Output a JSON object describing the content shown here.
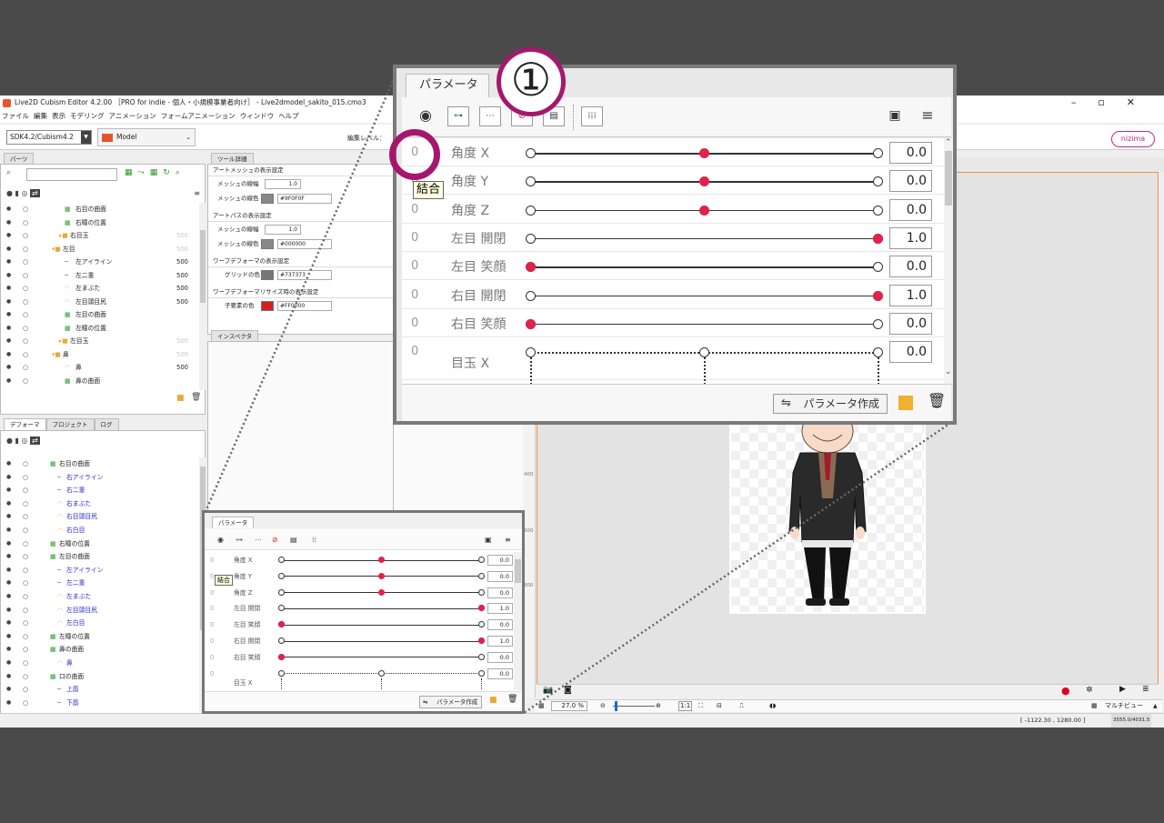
{
  "app": {
    "title": "Live2D Cubism Editor 4.2.00 ［PRO for indie - 個人・小規模事業者向け］ - Live2dmodel_sakito_015.cmo3",
    "menu": [
      "ファイル",
      "編集",
      "表示",
      "モデリング",
      "アニメーション",
      "フォームアニメーション",
      "ウィンドウ",
      "ヘルプ"
    ],
    "sdk_select": "SDK4.2/Cubism4.2",
    "model_label": "Model",
    "edit_level_label": "編集レベル：",
    "nizima": "nizima",
    "window_controls": [
      "–",
      "▫",
      "✕"
    ]
  },
  "parts_panel": {
    "tab": "パーツ",
    "items": [
      {
        "label": "右目の曲面",
        "num": "",
        "indent": 70,
        "color": "",
        "icon": "deformer"
      },
      {
        "label": "右瞳の位置",
        "num": "",
        "indent": 70,
        "color": "",
        "icon": "deformer"
      },
      {
        "label": "右目玉",
        "num": "500",
        "indent": 64,
        "color": "",
        "icon": "folder",
        "dim_num": true
      },
      {
        "label": "左目",
        "num": "500",
        "indent": 56,
        "color": "",
        "icon": "folder-open",
        "dim_num": true
      },
      {
        "label": "左アイライン",
        "num": "500",
        "indent": 70,
        "color": "",
        "icon": "line"
      },
      {
        "label": "左二重",
        "num": "500",
        "indent": 70,
        "color": "",
        "icon": "line"
      },
      {
        "label": "左まぶた",
        "num": "500",
        "indent": 70,
        "color": "",
        "icon": "mesh"
      },
      {
        "label": "左目頭目尻",
        "num": "500",
        "indent": 70,
        "color": "",
        "icon": "mesh"
      },
      {
        "label": "左目の曲面",
        "num": "",
        "indent": 70,
        "color": "",
        "icon": "deformer"
      },
      {
        "label": "左瞳の位置",
        "num": "",
        "indent": 70,
        "color": "",
        "icon": "deformer"
      },
      {
        "label": "左目玉",
        "num": "500",
        "indent": 64,
        "color": "",
        "icon": "folder",
        "dim_num": true
      },
      {
        "label": "鼻",
        "num": "500",
        "indent": 56,
        "color": "",
        "icon": "folder-open",
        "dim_num": true
      },
      {
        "label": "鼻",
        "num": "500",
        "indent": 70,
        "color": "",
        "icon": "mesh"
      },
      {
        "label": "鼻の曲面",
        "num": "",
        "indent": 70,
        "color": "",
        "icon": "deformer"
      }
    ]
  },
  "tool_detail": {
    "tab": "ツール詳細",
    "sections": [
      {
        "title": "アートメッシュの表示設定",
        "rows": [
          {
            "label": "メッシュの線幅",
            "value": "1.0"
          },
          {
            "label": "メッシュの線色",
            "hex": "#9F0F0F",
            "swatch": "#888888"
          }
        ]
      },
      {
        "title": "アートパスの表示設定",
        "rows": [
          {
            "label": "メッシュの線幅",
            "value": "1.0"
          },
          {
            "label": "メッシュの線色",
            "hex": "#000000",
            "swatch": "#888888"
          }
        ]
      },
      {
        "title": "ワープデフォーマの表示設定",
        "rows": [
          {
            "label": "グリッドの色",
            "hex": "#737373",
            "swatch": "#777777"
          }
        ]
      },
      {
        "title": "ワープデフォーマリサイズ時の表示設定",
        "rows": [
          {
            "label": "子要素の色",
            "hex": "#FF0000",
            "swatch": "#d42020"
          }
        ]
      }
    ],
    "inspector_tab": "インスペクタ"
  },
  "deformer_panel": {
    "tabs": [
      "デフォーマ",
      "プロジェクト",
      "ログ"
    ],
    "items": [
      {
        "label": "右目の曲面",
        "indent": 54,
        "color": "",
        "icon": "deformer"
      },
      {
        "label": "右アイライン",
        "indent": 62,
        "color": "blue",
        "icon": "line"
      },
      {
        "label": "右二重",
        "indent": 62,
        "color": "blue",
        "icon": "line"
      },
      {
        "label": "右まぶた",
        "indent": 62,
        "color": "blue",
        "icon": "mesh"
      },
      {
        "label": "右目頭目尻",
        "indent": 62,
        "color": "blue",
        "icon": "mesh"
      },
      {
        "label": "右白目",
        "indent": 62,
        "color": "blue",
        "icon": "mesh"
      },
      {
        "label": "右瞳の位置",
        "indent": 54,
        "color": "",
        "icon": "deformer"
      },
      {
        "label": "左目の曲面",
        "indent": 54,
        "color": "",
        "icon": "deformer"
      },
      {
        "label": "左アイライン",
        "indent": 62,
        "color": "blue",
        "icon": "line"
      },
      {
        "label": "左二重",
        "indent": 62,
        "color": "blue",
        "icon": "line"
      },
      {
        "label": "左まぶた",
        "indent": 62,
        "color": "blue",
        "icon": "mesh"
      },
      {
        "label": "左目頭目尻",
        "indent": 62,
        "color": "blue",
        "icon": "mesh"
      },
      {
        "label": "左白目",
        "indent": 62,
        "color": "blue",
        "icon": "mesh"
      },
      {
        "label": "左瞳の位置",
        "indent": 54,
        "color": "",
        "icon": "deformer"
      },
      {
        "label": "鼻の曲面",
        "indent": 54,
        "color": "",
        "icon": "deformer"
      },
      {
        "label": "鼻",
        "indent": 62,
        "color": "blue",
        "icon": "mesh"
      },
      {
        "label": "口の曲面",
        "indent": 54,
        "color": "",
        "icon": "deformer"
      },
      {
        "label": "上唇",
        "indent": 62,
        "color": "blue",
        "icon": "line"
      },
      {
        "label": "下唇",
        "indent": 62,
        "color": "blue",
        "icon": "line"
      }
    ]
  },
  "parameters": {
    "tab": "パラメータ",
    "tooltip": "結合",
    "create_button": "パラメータ作成",
    "items": [
      {
        "name": "角度 X",
        "value": "0.0",
        "knob": 0.5
      },
      {
        "name": "角度 Y",
        "value": "0.0",
        "knob": 0.5
      },
      {
        "name": "角度 Z",
        "value": "0.0",
        "knob": 0.5
      },
      {
        "name": "左目 開閉",
        "value": "1.0",
        "knob": 1.0
      },
      {
        "name": "左目 笑顔",
        "value": "0.0",
        "knob": 0.0
      },
      {
        "name": "右目 開閉",
        "value": "1.0",
        "knob": 1.0
      },
      {
        "name": "右目 笑顔",
        "value": "0.0",
        "knob": 0.0
      },
      {
        "name": "目玉 X",
        "value": "0.0",
        "knob": null
      }
    ]
  },
  "callout": {
    "number": "①"
  },
  "viewport": {
    "ruler_marks": [
      "400",
      "600",
      "800"
    ],
    "zoom": "27.0 %",
    "fit_buttons": [
      "1:1"
    ],
    "multiview_label": "マルチビュー",
    "coords": "[ -1122.30 , 1280.00 ]",
    "size_readout": "3555.0/4031.5"
  },
  "colors": {
    "accent": "#a5176e",
    "knob": "#e0234a",
    "viewport_border": "#f0903a",
    "brand": "#e8542c"
  }
}
